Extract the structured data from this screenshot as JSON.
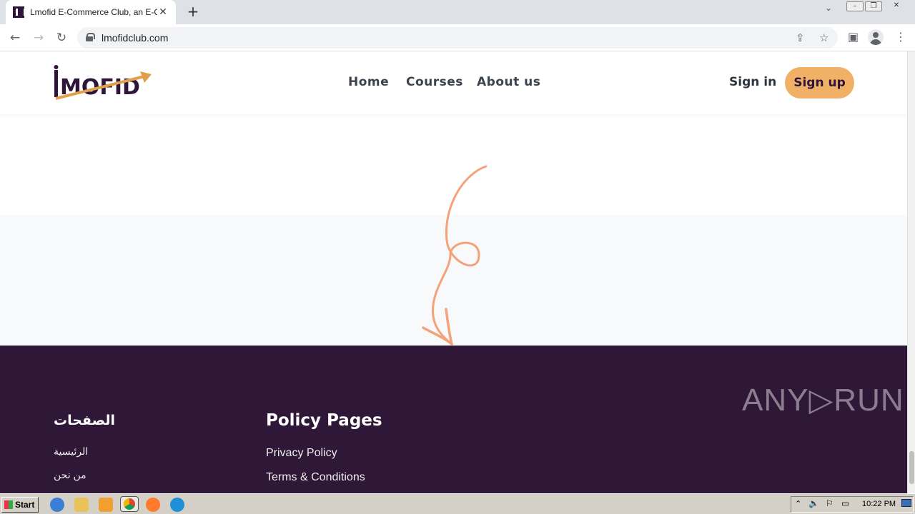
{
  "browser": {
    "tab_title": "Lmofid E-Commerce Club, an E-Comm",
    "tab_close": "✕",
    "new_tab": "+",
    "url": "lmofidclub.com"
  },
  "site": {
    "logo_text": "MOFID",
    "nav": [
      "Home",
      "Courses",
      "About us"
    ],
    "sign_in": "Sign in",
    "sign_up": "Sign up"
  },
  "footer": {
    "col1": {
      "heading": "الصفحات",
      "links": [
        "الرئيسية",
        "من نحن"
      ]
    },
    "col2": {
      "heading": "Policy Pages",
      "links": [
        "Privacy Policy",
        "Terms & Conditions"
      ]
    },
    "watermark": "ANY▷RUN"
  },
  "taskbar": {
    "start": "Start",
    "clock": "10:22 PM"
  },
  "colors": {
    "brand_dark": "#2f1737",
    "accent": "#f0b066",
    "arrow": "#f4a27a"
  }
}
